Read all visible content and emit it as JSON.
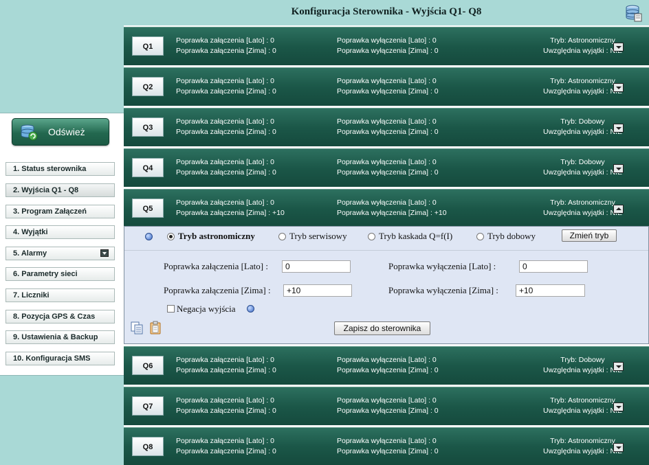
{
  "header": {
    "title": "Konfiguracja Sterownika - Wyjścia Q1- Q8",
    "db_icon": "database-icon"
  },
  "sidebar": {
    "refresh": {
      "label": "Odśwież",
      "icon": "refresh-database-icon"
    },
    "items": [
      {
        "label": "1. Status sterownika"
      },
      {
        "label": "2. Wyjścia Q1 - Q8",
        "active": true
      },
      {
        "label": "3. Program Załączeń"
      },
      {
        "label": "4. Wyjątki"
      },
      {
        "label": "5. Alarmy",
        "has_submenu": true
      },
      {
        "label": "6. Parametry sieci"
      },
      {
        "label": "7. Liczniki"
      },
      {
        "label": "8. Pozycja GPS & Czas"
      },
      {
        "label": "9. Ustawienia & Backup"
      },
      {
        "label": "10. Konfiguracja SMS"
      }
    ]
  },
  "outputs": [
    {
      "name": "Q1",
      "on_summer": "Poprawka załączenia [Lato] : 0",
      "on_winter": "Poprawka załączenia [Zima] : 0",
      "off_summer": "Poprawka wyłączenia [Lato] : 0",
      "off_winter": "Poprawka wyłączenia [Zima] : 0",
      "mode": "Tryb: Astronomiczny",
      "exceptions": "Uwzględnia wyjątki : NIE"
    },
    {
      "name": "Q2",
      "on_summer": "Poprawka załączenia [Lato] : 0",
      "on_winter": "Poprawka załączenia [Zima] : 0",
      "off_summer": "Poprawka wyłączenia [Lato] : 0",
      "off_winter": "Poprawka wyłączenia [Zima] : 0",
      "mode": "Tryb: Astronomiczny",
      "exceptions": "Uwzględnia wyjątki : NIE"
    },
    {
      "name": "Q3",
      "on_summer": "Poprawka załączenia [Lato] : 0",
      "on_winter": "Poprawka załączenia [Zima] : 0",
      "off_summer": "Poprawka wyłączenia [Lato] : 0",
      "off_winter": "Poprawka wyłączenia [Zima] : 0",
      "mode": "Tryb: Dobowy",
      "exceptions": "Uwzględnia wyjątki : NIE"
    },
    {
      "name": "Q4",
      "on_summer": "Poprawka załączenia [Lato] : 0",
      "on_winter": "Poprawka załączenia [Zima] : 0",
      "off_summer": "Poprawka wyłączenia [Lato] : 0",
      "off_winter": "Poprawka wyłączenia [Zima] : 0",
      "mode": "Tryb: Dobowy",
      "exceptions": "Uwzględnia wyjątki : NIE"
    },
    {
      "name": "Q5",
      "on_summer": "Poprawka załączenia [Lato] : 0",
      "on_winter": "Poprawka załączenia [Zima] : +10",
      "off_summer": "Poprawka wyłączenia [Lato] : 0",
      "off_winter": "Poprawka wyłączenia [Zima] : +10",
      "mode": "Tryb: Astronomiczny",
      "exceptions": "Uwzględnia wyjątki : NIE",
      "expanded": true
    },
    {
      "name": "Q6",
      "on_summer": "Poprawka załączenia [Lato] : 0",
      "on_winter": "Poprawka załączenia [Zima] : 0",
      "off_summer": "Poprawka wyłączenia [Lato] : 0",
      "off_winter": "Poprawka wyłączenia [Zima] : 0",
      "mode": "Tryb: Dobowy",
      "exceptions": "Uwzględnia wyjątki : NIE"
    },
    {
      "name": "Q7",
      "on_summer": "Poprawka załączenia [Lato] : 0",
      "on_winter": "Poprawka załączenia [Zima] : 0",
      "off_summer": "Poprawka wyłączenia [Lato] : 0",
      "off_winter": "Poprawka wyłączenia [Zima] : 0",
      "mode": "Tryb: Astronomiczny",
      "exceptions": "Uwzględnia wyjątki : NIE"
    },
    {
      "name": "Q8",
      "on_summer": "Poprawka załączenia [Lato] : 0",
      "on_winter": "Poprawka załączenia [Zima] : 0",
      "off_summer": "Poprawka wyłączenia [Lato] : 0",
      "off_winter": "Poprawka wyłączenia [Zima] : 0",
      "mode": "Tryb: Astronomiczny",
      "exceptions": "Uwzględnia wyjątki : NIE"
    }
  ],
  "panel": {
    "modes": [
      {
        "label": "Tryb astronomiczny",
        "checked": true
      },
      {
        "label": "Tryb serwisowy"
      },
      {
        "label": "Tryb kaskada Q=f(I)"
      },
      {
        "label": "Tryb dobowy"
      }
    ],
    "change_mode_label": "Zmień tryb",
    "on_summer_label": "Poprawka załączenia [Lato] :",
    "on_summer_value": "0",
    "on_winter_label": "Poprawka załączenia [Zima] :",
    "on_winter_value": "+10",
    "off_summer_label": "Poprawka wyłączenia [Lato] :",
    "off_summer_value": "0",
    "off_winter_label": "Poprawka wyłączenia [Zima] :",
    "off_winter_value": "+10",
    "negation_label": "Negacja wyjścia",
    "negation_checked": false,
    "save_label": "Zapisz do sterownika",
    "copy_icon": "copy-icon",
    "paste_icon": "paste-icon",
    "help_icon": "help-icon"
  },
  "colors": {
    "row_bg": "#1b5748",
    "sidebar_bg": "#a9d9d6",
    "panel_bg": "#dfe6f4"
  }
}
